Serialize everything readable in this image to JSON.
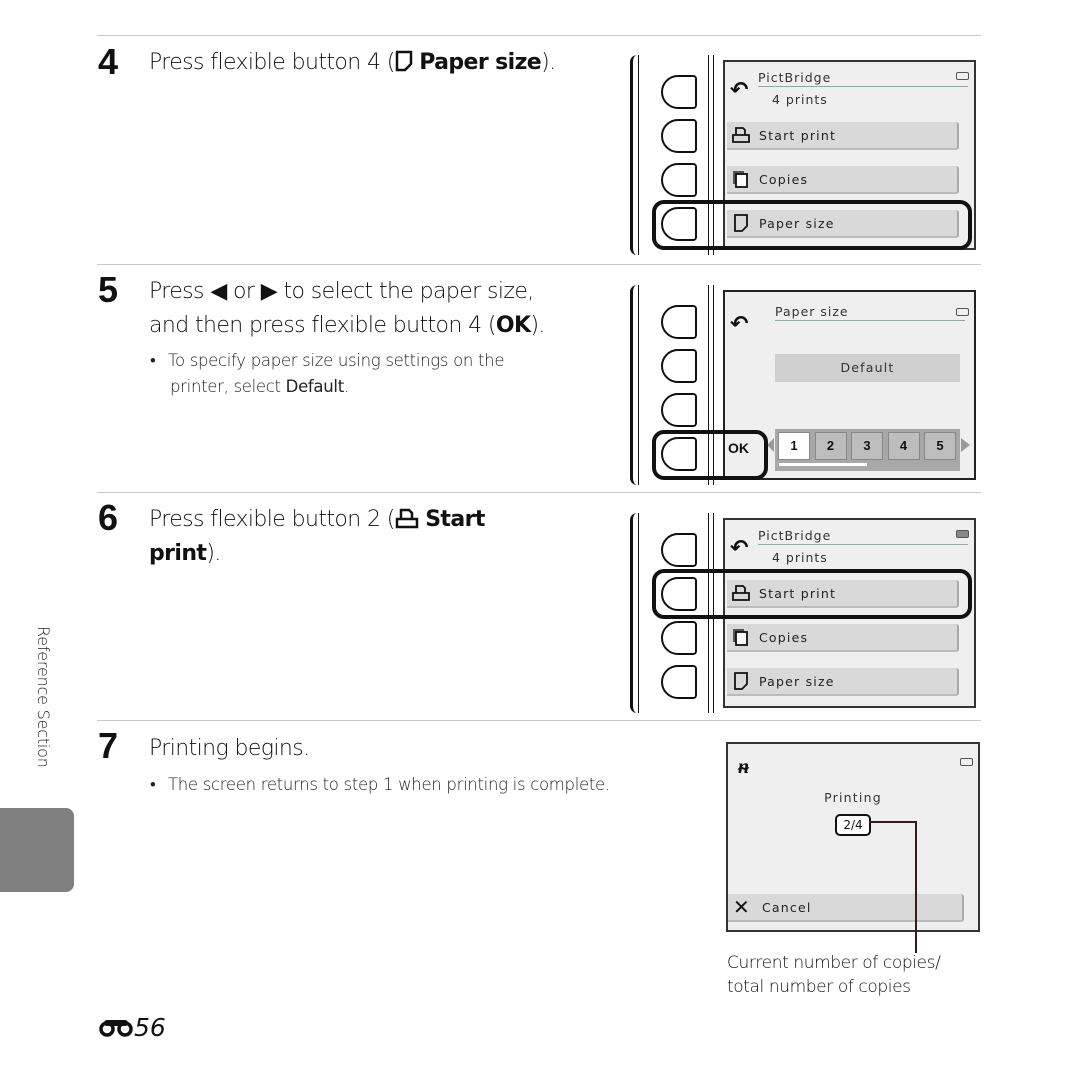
{
  "side_tab": {
    "label": "Reference Section",
    "tab_color": "#808080"
  },
  "page_number": {
    "icon": "binoculars-icon",
    "number": "56"
  },
  "steps": [
    {
      "number": "4",
      "text_pre": "Press flexible button 4 (",
      "icon": "paper-size-icon",
      "text_bold": "Paper size",
      "text_post": ")."
    },
    {
      "number": "5",
      "line1_pre": "Press",
      "left_arrow": "◀",
      "line1_mid": "or",
      "right_arrow": "▶",
      "line1_post": "to select the paper size,",
      "line2_pre": "and then press flexible button 4 (",
      "line2_bold": "OK",
      "line2_post": ").",
      "bullet_line1": "To specify paper size using settings on the",
      "bullet_line2_pre": "printer, select ",
      "bullet_line2_bold": "Default",
      "bullet_line2_post": "."
    },
    {
      "number": "6",
      "text_pre": "Press flexible button 2 (",
      "icon": "printer-icon",
      "text_bold1": "Start",
      "text_bold2": "print",
      "text_post": ")."
    },
    {
      "number": "7",
      "text": "Printing begins.",
      "bullet": "The screen returns to step 1 when printing is complete."
    }
  ],
  "screen_menu": {
    "title": "PictBridge",
    "subtitle": "4 prints",
    "items": [
      {
        "label": "Start print",
        "icon": "printer-icon"
      },
      {
        "label": "Copies",
        "icon": "copies-icon"
      },
      {
        "label": "Paper size",
        "icon": "paper-size-icon"
      }
    ]
  },
  "screen_paper": {
    "title": "Paper size",
    "selected_value": "Default",
    "ok_label": "OK",
    "options": [
      "1",
      "2",
      "3",
      "4",
      "5"
    ],
    "selected_index": 0
  },
  "screen_printing": {
    "status": "Printing",
    "counter": "2/4",
    "current": 2,
    "total": 4,
    "cancel_label": "Cancel",
    "callout": [
      "Current number of copies/",
      "total number of copies"
    ]
  }
}
